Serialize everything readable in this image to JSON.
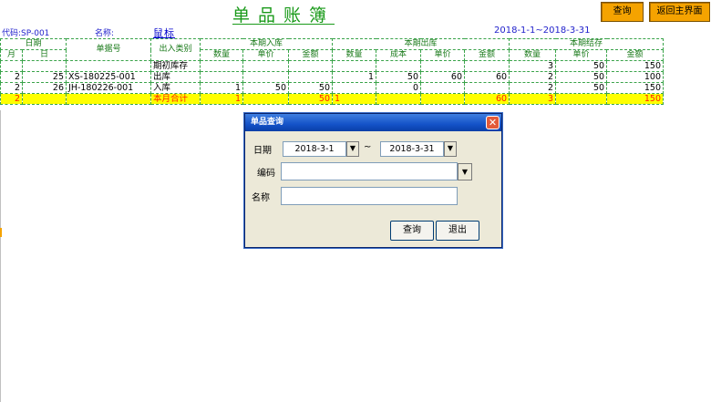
{
  "title": "单品账簿",
  "buttons": {
    "query": "查询",
    "back": "返回主界面"
  },
  "info": {
    "code": "代码:SP-001",
    "name_label": "名称:",
    "name_value": "鼠标",
    "date_range": "2018-1-1~2018-3-31"
  },
  "ledger": {
    "group_headers": {
      "date": "日期",
      "doc_no": "单据号",
      "io_type": "出入类别",
      "in": "本期入库",
      "out": "本期出库",
      "balance": "本期结存"
    },
    "sub_headers": {
      "month": "月",
      "day": "日",
      "qty": "数量",
      "price": "单价",
      "amount": "金额",
      "cost": "成本"
    },
    "rows": [
      {
        "m": "",
        "d": "",
        "doc": "",
        "type": "期初库存",
        "in_qty": "",
        "in_price": "",
        "in_amt": "",
        "out_qty": "",
        "out_cost": "",
        "out_price": "",
        "out_amt": "",
        "bal_qty": "3",
        "bal_price": "50",
        "bal_amt": "150"
      },
      {
        "m": "2",
        "d": "25",
        "doc": "XS-180225-001",
        "type": "出库",
        "in_qty": "",
        "in_price": "",
        "in_amt": "",
        "out_qty": "1",
        "out_cost": "50",
        "out_price": "60",
        "out_amt": "60",
        "bal_qty": "2",
        "bal_price": "50",
        "bal_amt": "100"
      },
      {
        "m": "2",
        "d": "26",
        "doc": "JH-180226-001",
        "type": "入库",
        "in_qty": "1",
        "in_price": "50",
        "in_amt": "50",
        "out_qty": "",
        "out_cost": "0",
        "out_price": "",
        "out_amt": "",
        "bal_qty": "2",
        "bal_price": "50",
        "bal_amt": "150"
      }
    ],
    "summary": {
      "m": "2",
      "type": "本月合计",
      "in_qty": "1",
      "in_amt": "50",
      "out_qty": "1",
      "out_amt": "60",
      "bal_qty": "3",
      "bal_amt": "150"
    }
  },
  "dialog": {
    "title": "单品查询",
    "date_label": "日期",
    "date_from": "2018-3-1",
    "date_sep": "~",
    "date_to": "2018-3-31",
    "code_label": "编码",
    "code_value": "",
    "name_label": "名称",
    "name_value": "",
    "query_button": "查询",
    "exit_button": "退出"
  },
  "colors": {
    "title_green": "#1a9a1a",
    "button_orange": "#f5a300",
    "summary_yellow": "#ffff00",
    "summary_red": "#ff2200",
    "grid_green": "#3aa34a"
  }
}
